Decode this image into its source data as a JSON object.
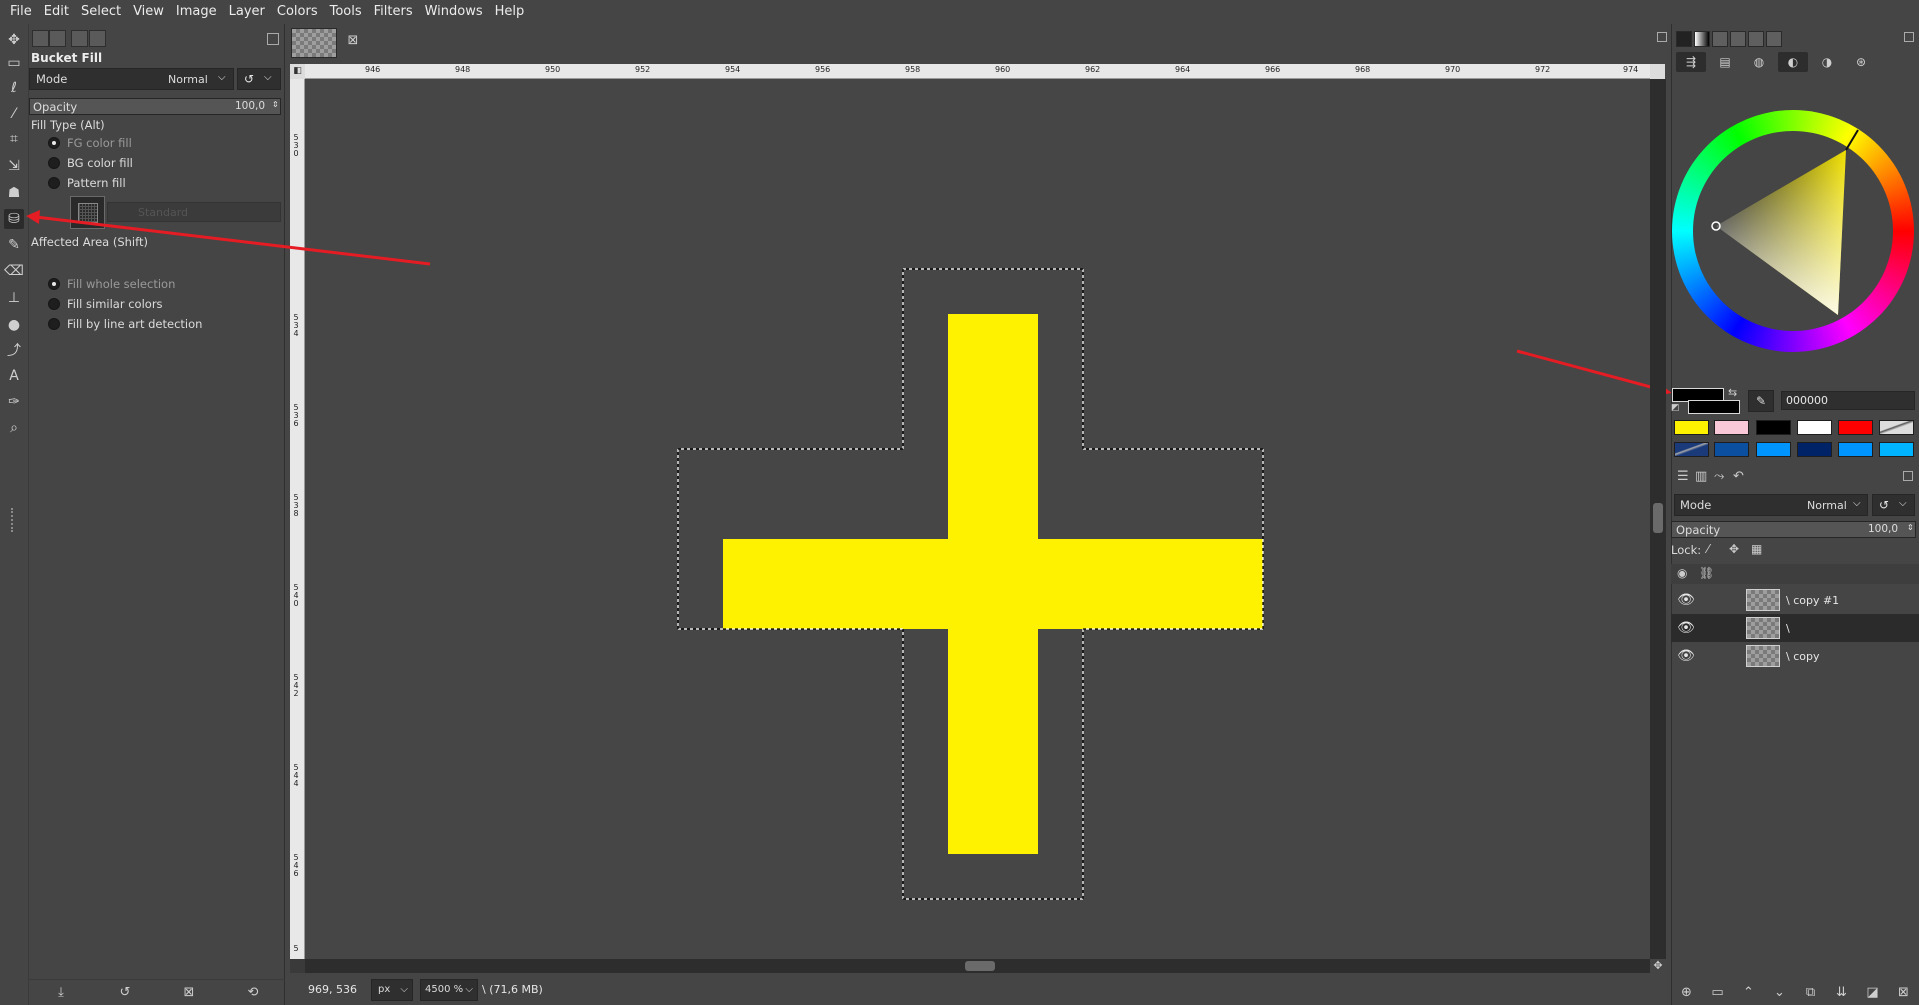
{
  "menubar": [
    "File",
    "Edit",
    "Select",
    "View",
    "Image",
    "Layer",
    "Colors",
    "Tools",
    "Filters",
    "Windows",
    "Help"
  ],
  "tool_options": {
    "title": "Bucket Fill",
    "mode_label": "Mode",
    "mode_value": "Normal",
    "opacity_label": "Opacity",
    "opacity_value": "100,0",
    "fill_type_label": "Fill Type  (Alt)",
    "fill_types": [
      "FG color fill",
      "BG color fill",
      "Pattern fill"
    ],
    "pattern_name": "Standard",
    "affected_area_label": "Affected Area  (Shift)",
    "affected_areas": [
      "Fill whole selection",
      "Fill similar colors",
      "Fill by line art detection"
    ]
  },
  "ruler_h_labels": [
    "946",
    "948",
    "950",
    "952",
    "954",
    "956",
    "958",
    "960",
    "962",
    "964",
    "966",
    "968",
    "970",
    "972",
    "974"
  ],
  "ruler_v_labels": [
    "530",
    "534",
    "536",
    "538",
    "540",
    "542",
    "544",
    "546",
    "5"
  ],
  "statusbar": {
    "coords": "969, 536",
    "unit": "px",
    "zoom": "4500 %",
    "info": "\\ (71,6 MB)"
  },
  "colors": {
    "fg_hex": "000000",
    "yellow": "#fff200",
    "swatches_row1": [
      "#fff200",
      "#f8c8d8",
      "#000000",
      "#ffffff",
      "#ff0000"
    ],
    "swatches_row2": [
      "#1a3a7a",
      "#0a4fa0",
      "#0094ff",
      "#002266",
      "#0094ff",
      "#00b4ff"
    ]
  },
  "layers_panel": {
    "mode_label": "Mode",
    "mode_value": "Normal",
    "opacity_label": "Opacity",
    "opacity_value": "100,0",
    "lock_label": "Lock:",
    "layers": [
      {
        "name": "\\ copy #1",
        "selected": false
      },
      {
        "name": "\\",
        "selected": true
      },
      {
        "name": "\\ copy",
        "selected": false
      }
    ]
  },
  "icons": {
    "tools": [
      "move-icon",
      "rect-select-icon",
      "lasso-icon",
      "fuzzy-select-icon",
      "crop-icon",
      "transform-icon",
      "warp-icon",
      "bucket-fill-icon",
      "paintbrush-icon",
      "eraser-icon",
      "clone-icon",
      "smudge-icon",
      "paths-icon",
      "text-icon",
      "color-picker-icon",
      "zoom-icon"
    ]
  }
}
